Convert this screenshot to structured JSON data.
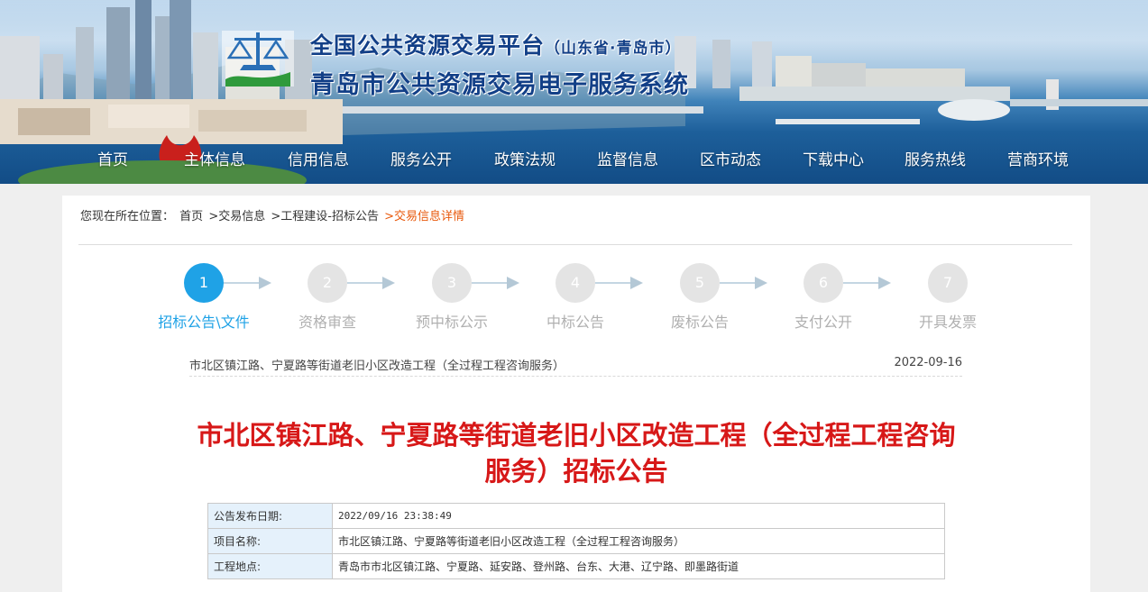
{
  "site": {
    "title_line1": "全国公共资源交易平台",
    "title_line1_sub": "（山东省·青岛市）",
    "title_line2": "青岛市公共资源交易电子服务系统"
  },
  "nav": [
    "首页",
    "主体信息",
    "信用信息",
    "服务公开",
    "政策法规",
    "监督信息",
    "区市动态",
    "下载中心",
    "服务热线",
    "营商环境"
  ],
  "breadcrumb": {
    "prefix": "您现在所在位置：",
    "items": [
      "首页",
      ">交易信息",
      ">工程建设-招标公告",
      ">交易信息详情"
    ]
  },
  "steps": [
    {
      "num": "1",
      "label": "招标公告\\文件",
      "active": true
    },
    {
      "num": "2",
      "label": "资格审查",
      "active": false
    },
    {
      "num": "3",
      "label": "预中标公示",
      "active": false
    },
    {
      "num": "4",
      "label": "中标公告",
      "active": false
    },
    {
      "num": "5",
      "label": "废标公告",
      "active": false
    },
    {
      "num": "6",
      "label": "支付公开",
      "active": false
    },
    {
      "num": "7",
      "label": "开具发票",
      "active": false
    }
  ],
  "project": {
    "name": "市北区镇江路、宁夏路等街道老旧小区改造工程（全过程工程咨询服务）",
    "date": "2022-09-16"
  },
  "notice": {
    "title_line1": "市北区镇江路、宁夏路等街道老旧小区改造工程（全过程工程咨询",
    "title_line2": "服务）招标公告"
  },
  "info_table": [
    {
      "key": "公告发布日期:",
      "value": "2022/09/16 23:38:49"
    },
    {
      "key": "项目名称:",
      "value": "市北区镇江路、宁夏路等街道老旧小区改造工程（全过程工程咨询服务）"
    },
    {
      "key": "工程地点:",
      "value": "青岛市市北区镇江路、宁夏路、延安路、登州路、台东、大港、辽宁路、即墨路街道"
    }
  ],
  "colors": {
    "nav_text": "#ffffff",
    "step_active": "#1fa2e6",
    "step_inactive": "#e4e4e4",
    "headline": "#d71818",
    "crumb_current": "#e8590c",
    "table_key_bg": "#e5f1fb"
  }
}
